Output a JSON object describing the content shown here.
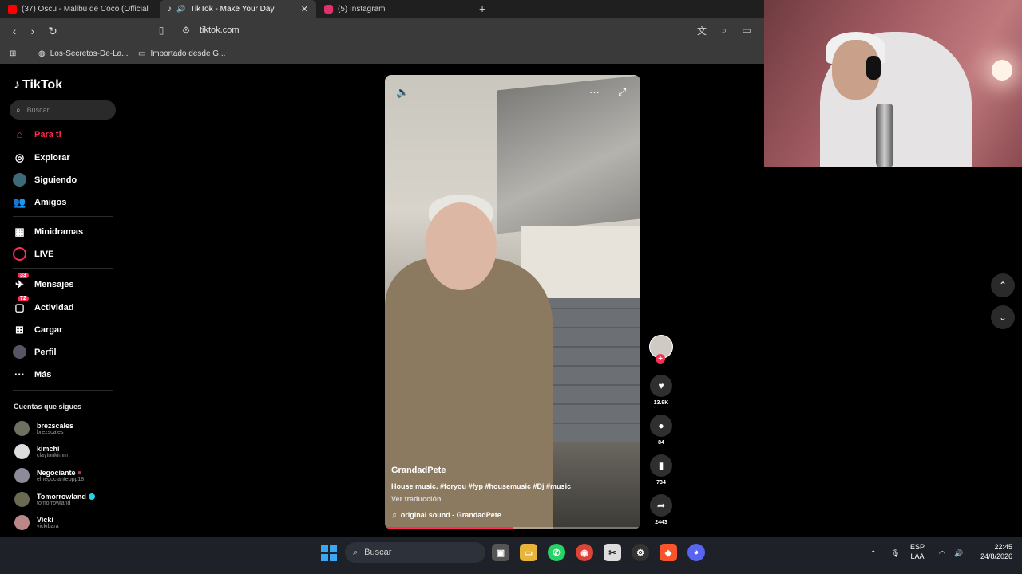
{
  "browser": {
    "tabs": [
      {
        "label": "(37) Oscu - Malibu de Coco (Official",
        "favicon_color": "#ff0000"
      },
      {
        "label": "TikTok - Make Your Day",
        "favicon_color": "#000000",
        "active": true
      },
      {
        "label": "(5) Instagram",
        "favicon_color": "#e1306c"
      }
    ],
    "url": "tiktok.com",
    "bookmarks": [
      "Los-Secretos-De-La...",
      "Importado desde G..."
    ]
  },
  "tiktok": {
    "logo": "TikTok",
    "search_placeholder": "Buscar",
    "nav": [
      {
        "label": "Para ti",
        "icon": "home-icon"
      },
      {
        "label": "Explorar",
        "icon": "compass-icon"
      },
      {
        "label": "Siguiendo",
        "icon": "following-icon"
      },
      {
        "label": "Amigos",
        "icon": "friends-icon"
      },
      {
        "label": "Minidramas",
        "icon": "film-icon"
      },
      {
        "label": "LIVE",
        "icon": "live-icon"
      },
      {
        "label": "Mensajes",
        "icon": "message-icon",
        "badge": "33"
      },
      {
        "label": "Actividad",
        "icon": "activity-icon",
        "badge": "72"
      },
      {
        "label": "Cargar",
        "icon": "upload-icon"
      },
      {
        "label": "Perfil",
        "icon": "profile-icon"
      },
      {
        "label": "Más",
        "icon": "more-icon"
      }
    ],
    "following_title": "Cuentas que sigues",
    "accounts": [
      {
        "name": "brezscales",
        "handle": "brezscales"
      },
      {
        "name": "kimchi",
        "handle": "claytonkimm"
      },
      {
        "name": "Negociante",
        "handle": "elnegocianteppp18"
      },
      {
        "name": "Tomorrowland",
        "handle": "tomorrowland",
        "verified": true
      },
      {
        "name": "Vicki",
        "handle": "vickibara"
      }
    ],
    "video": {
      "author": "GrandadPete",
      "description": "House music. #foryou #fyp #housemusic #Dj #music",
      "translate": "Ver traducción",
      "sound": "original sound - GrandadPete",
      "progress": 0.5
    },
    "actions": {
      "likes": "13.9K",
      "comments": "84",
      "saves": "734",
      "shares": "2443"
    }
  },
  "taskbar": {
    "search": "Buscar",
    "lang_top": "ESP",
    "lang_bottom": "LAA",
    "time": "22:45",
    "date": "24/8/2026"
  }
}
